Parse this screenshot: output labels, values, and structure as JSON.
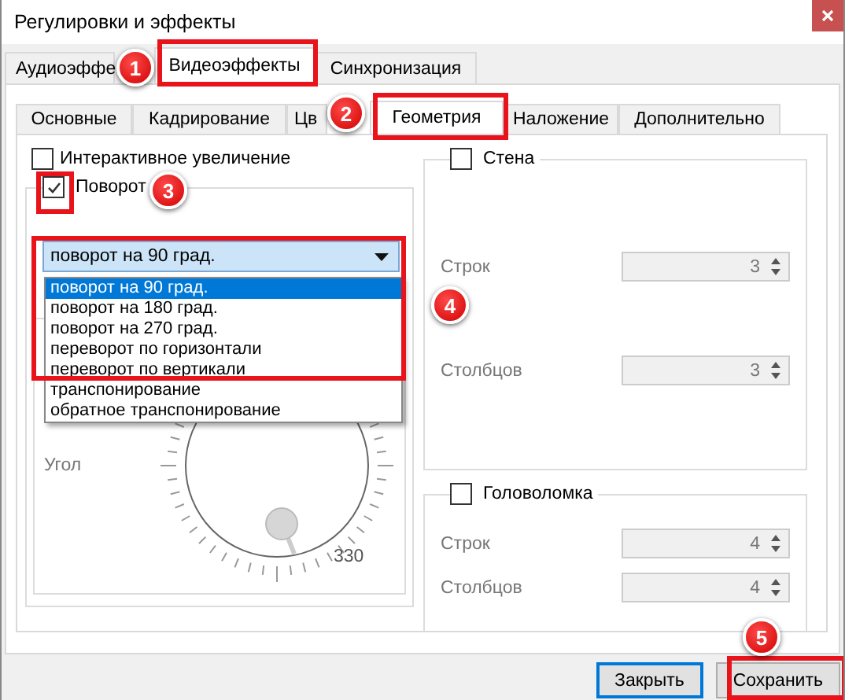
{
  "window": {
    "title": "Регулировки и эффекты"
  },
  "tabs": [
    {
      "label": "Аудиоэффе",
      "selected": false
    },
    {
      "label": "Видеоэффекты",
      "selected": true
    },
    {
      "label": "Синхронизация",
      "selected": false
    }
  ],
  "subtabs": [
    {
      "label": "Основные",
      "selected": false
    },
    {
      "label": "Кадрирование",
      "selected": false
    },
    {
      "label": "Цв",
      "selected": false
    },
    {
      "label": "Геометрия",
      "selected": true
    },
    {
      "label": "Наложение",
      "selected": false
    },
    {
      "label": "Дополнительно",
      "selected": false
    }
  ],
  "zoom_checkbox": {
    "label": "Интерактивное увеличение",
    "checked": false
  },
  "rotate": {
    "label": "Поворот",
    "checked": true,
    "value": "поворот на 90 град.",
    "options": [
      {
        "label": "поворот на 90 град.",
        "selected": true
      },
      {
        "label": "поворот на 180 град.",
        "selected": false
      },
      {
        "label": "поворот на 270 град.",
        "selected": false
      },
      {
        "label": "переворот по горизонтали",
        "selected": false
      },
      {
        "label": "переворот по вертикали",
        "selected": false
      },
      {
        "label": "транспонирование",
        "selected": false
      },
      {
        "label": "обратное транспонирование",
        "selected": false
      }
    ],
    "angle_label": "Угол",
    "angle_value": "330"
  },
  "groups": [
    {
      "label": "Стена",
      "checked": false,
      "fields": [
        {
          "label": "Строк",
          "value": "3"
        },
        {
          "label": "Столбцов",
          "value": "3"
        }
      ]
    },
    {
      "label": "Головоломка",
      "checked": false,
      "fields": [
        {
          "label": "Строк",
          "value": "4"
        },
        {
          "label": "Столбцов",
          "value": "4"
        }
      ]
    }
  ],
  "buttons": [
    {
      "label": "Закрыть",
      "default": true
    },
    {
      "label": "Сохранить",
      "default": false
    }
  ],
  "annotations": [
    {
      "label": "1"
    },
    {
      "label": "2"
    },
    {
      "label": "3"
    },
    {
      "label": "4"
    },
    {
      "label": "5"
    }
  ]
}
